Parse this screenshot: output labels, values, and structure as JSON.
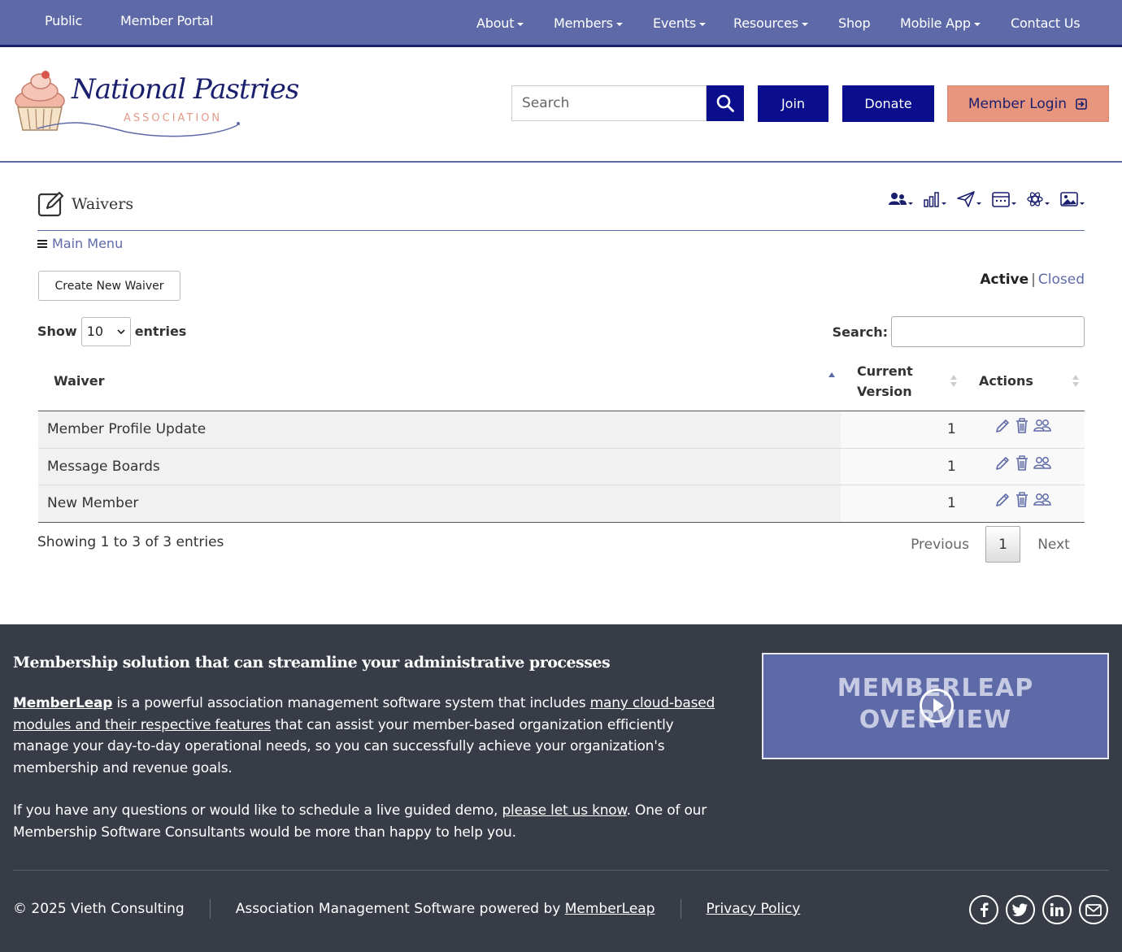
{
  "topnav": {
    "left": [
      "Public",
      "Member Portal"
    ],
    "right": [
      {
        "label": "About",
        "dropdown": true
      },
      {
        "label": "Members",
        "dropdown": true
      },
      {
        "label": "Events",
        "dropdown": true
      },
      {
        "label": "Resources",
        "dropdown": true
      },
      {
        "label": "Shop",
        "dropdown": false
      },
      {
        "label": "Mobile App",
        "dropdown": true
      },
      {
        "label": "Contact Us",
        "dropdown": false
      }
    ]
  },
  "header": {
    "logo_line1": "National Pastries",
    "logo_line2": "ASSOCIATION",
    "search_placeholder": "Search",
    "join": "Join",
    "donate": "Donate",
    "member_login": "Member Login"
  },
  "colors": {
    "nav_bg": "#5e6aa8",
    "primary": "#0a0e8c",
    "login_bg": "#e8957e",
    "footer_bg": "#373c47"
  },
  "page": {
    "title": "Waivers",
    "main_menu": "Main Menu",
    "create_button": "Create New Waiver",
    "status_active": "Active",
    "status_separator": "|",
    "status_closed": "Closed",
    "show_label": "Show",
    "entries_label": "entries",
    "page_length": "10",
    "search_label": "Search:"
  },
  "table": {
    "headers": {
      "waiver": "Waiver",
      "version_line1": "Current",
      "version_line2": "Version",
      "actions": "Actions"
    },
    "rows": [
      {
        "name": "Member Profile Update",
        "version": "1"
      },
      {
        "name": "Message Boards",
        "version": "1"
      },
      {
        "name": "New Member",
        "version": "1"
      }
    ]
  },
  "pagination": {
    "info": "Showing 1 to 3 of 3 entries",
    "previous": "Previous",
    "current": "1",
    "next": "Next"
  },
  "footer": {
    "title": "Membership solution that can streamline your administrative processes",
    "p1_link1": "MemberLeap",
    "p1_text1": " is a powerful association management software system that includes ",
    "p1_link2": "many cloud-based modules and their respective features",
    "p1_text2": " that can assist your member-based organization efficiently manage your day-to-day operational needs, so you can successfully achieve your organization's membership and revenue goals.",
    "p2_text1": "If you have any questions or would like to schedule a live guided demo, ",
    "p2_link": "please let us know",
    "p2_text2": ". One of our Membership Software Consultants would be more than happy to help you.",
    "video_line1": "MEMBERLEAP",
    "video_line2": "OVERVIEW",
    "copyright": "© 2025 Vieth Consulting",
    "powered_text": "Association Management Software powered by ",
    "powered_link": "MemberLeap",
    "privacy": "Privacy Policy",
    "social_icons": [
      "facebook-icon",
      "twitter-icon",
      "linkedin-icon",
      "email-icon"
    ]
  }
}
